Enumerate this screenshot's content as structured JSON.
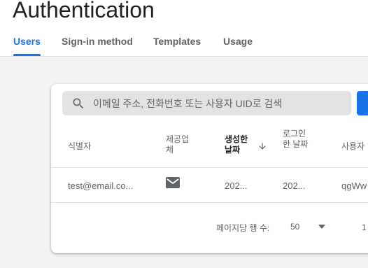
{
  "header": {
    "title": "Authentication",
    "tabs": [
      {
        "label": "Users",
        "active": true
      },
      {
        "label": "Sign-in method",
        "active": false
      },
      {
        "label": "Templates",
        "active": false
      },
      {
        "label": "Usage",
        "active": false
      }
    ]
  },
  "search": {
    "placeholder": "이메일 주소, 전화번호 또는 사용자 UID로 검색",
    "icon": "search-icon"
  },
  "table": {
    "columns": [
      {
        "label": "식별자"
      },
      {
        "label": "제공업체"
      },
      {
        "label": "생성한 날짜",
        "sorted": "desc"
      },
      {
        "label": "로그인한 날짜"
      },
      {
        "label": "사용자"
      }
    ],
    "rows": [
      {
        "identifier": "test@email.co...",
        "provider_icon": "mail-icon",
        "created": "202...",
        "signed_in": "202...",
        "uid": "qgWw"
      }
    ]
  },
  "pagination": {
    "rows_per_page_label": "페이지당 행 수:",
    "rows_per_page": "50",
    "range": "1"
  },
  "colors": {
    "accent": "#1a73e8",
    "background": "#f1f3f4",
    "search_bg": "#e3e3e3"
  }
}
